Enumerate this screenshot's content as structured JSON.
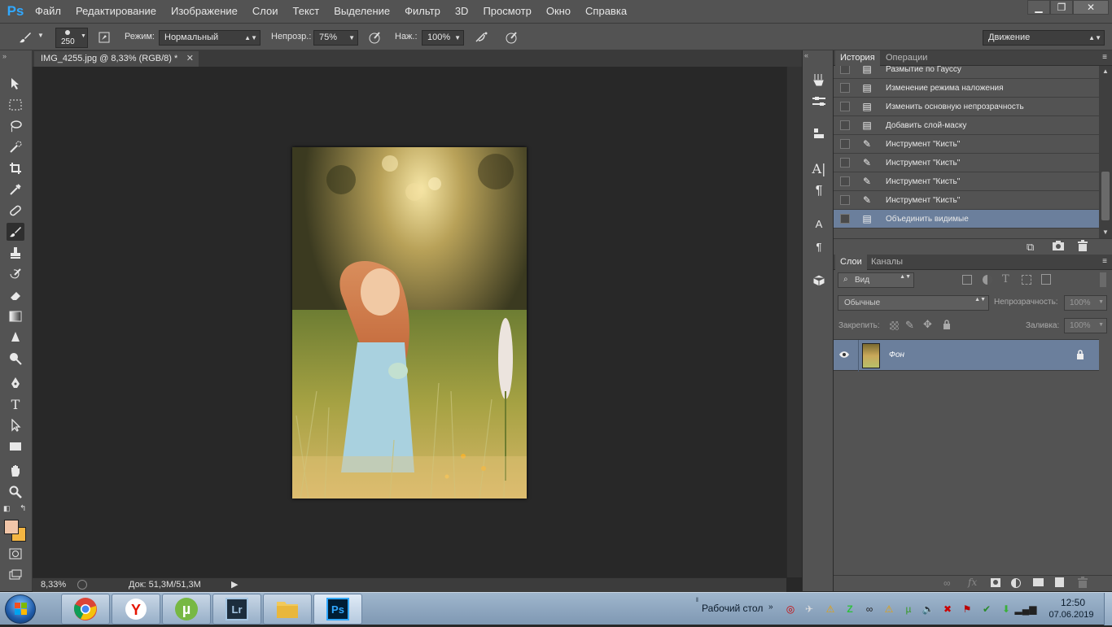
{
  "app": {
    "logo": "Ps"
  },
  "menu": [
    "Файл",
    "Редактирование",
    "Изображение",
    "Слои",
    "Текст",
    "Выделение",
    "Фильтр",
    "3D",
    "Просмотр",
    "Окно",
    "Справка"
  ],
  "window_controls": {
    "minimize": "▁",
    "restore": "❐",
    "close": "✕"
  },
  "options": {
    "brush_size": "250",
    "mode_label": "Режим:",
    "mode_value": "Нормальный",
    "opacity_label": "Непрозр.:",
    "opacity_value": "75%",
    "pressure_label": "Наж.:",
    "pressure_value": "100%",
    "workspace": "Движение"
  },
  "document": {
    "tab_title": "IMG_4255.jpg @ 8,33% (RGB/8) *",
    "zoom": "8,33%",
    "doc_info": "Док: 51,3M/51,3M"
  },
  "history_panel": {
    "tabs": [
      "История",
      "Операции"
    ],
    "items": [
      {
        "icon": "document-icon",
        "label": "Размытие по Гауссу"
      },
      {
        "icon": "document-icon",
        "label": "Изменение режима наложения"
      },
      {
        "icon": "document-icon",
        "label": "Изменить основную непрозрачность"
      },
      {
        "icon": "document-icon",
        "label": "Добавить слой-маску"
      },
      {
        "icon": "brush-icon",
        "label": "Инструмент \"Кисть\""
      },
      {
        "icon": "brush-icon",
        "label": "Инструмент \"Кисть\""
      },
      {
        "icon": "brush-icon",
        "label": "Инструмент \"Кисть\""
      },
      {
        "icon": "brush-icon",
        "label": "Инструмент \"Кисть\""
      },
      {
        "icon": "document-icon",
        "label": "Объединить видимые"
      }
    ]
  },
  "layers_panel": {
    "tabs": [
      "Слои",
      "Каналы"
    ],
    "filter_label": "Вид",
    "blend_mode": "Обычные",
    "opacity_label": "Непрозрачность:",
    "opacity_value": "100%",
    "lock_label": "Закрепить:",
    "fill_label": "Заливка:",
    "fill_value": "100%",
    "layers": [
      {
        "name": "Фон",
        "visible": true,
        "locked": true
      }
    ]
  },
  "taskbar": {
    "desktop_label": "Рабочий стол",
    "time": "12:50",
    "date": "07.06.2019"
  },
  "colors": {
    "foreground": "#f2c6a8",
    "background": "#f4b642",
    "accent": "#31a8ff",
    "selected_row": "#6b7f9c"
  }
}
